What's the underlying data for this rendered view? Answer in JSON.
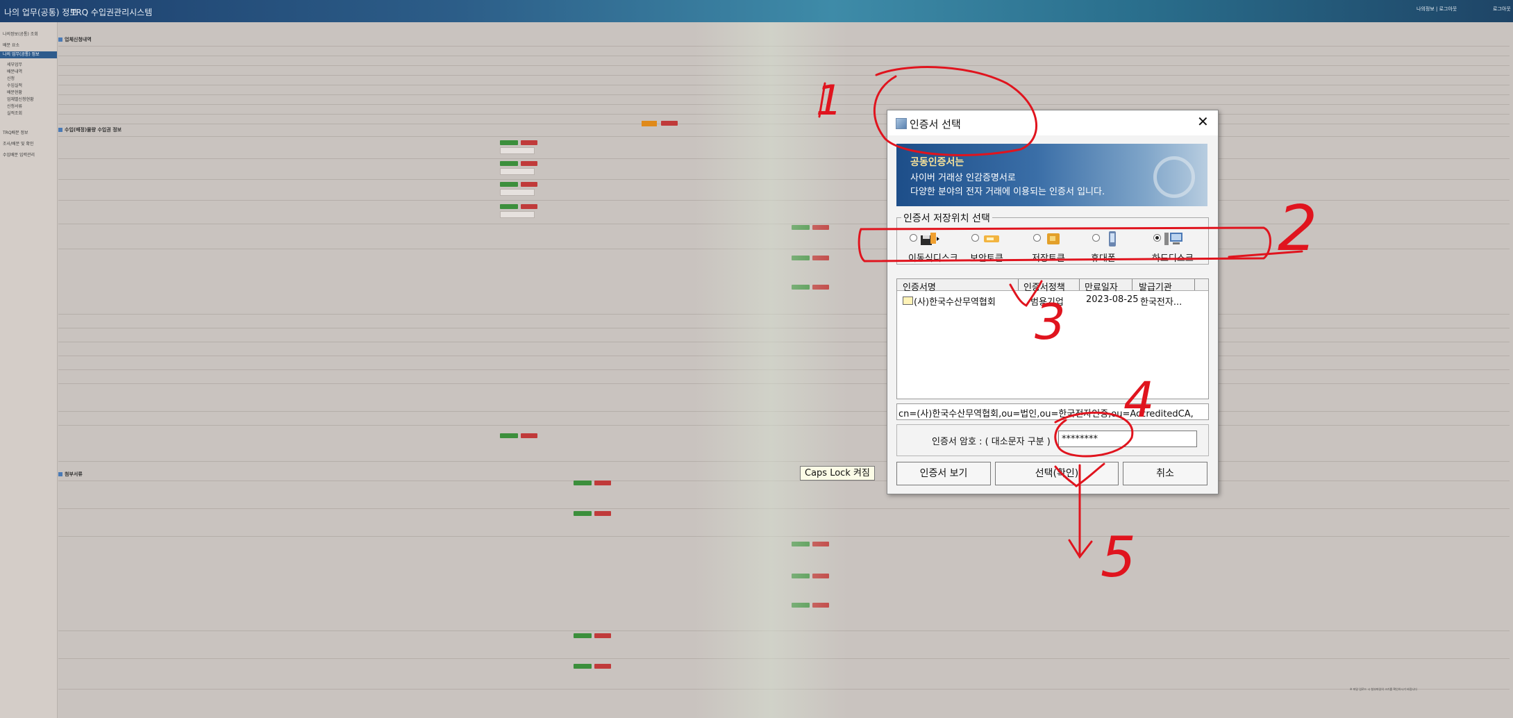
{
  "app": {
    "tab1": "나의 업무(공통) 정보",
    "tab2": "TRQ 수입권관리시스템",
    "util_text": "나의정보 | 로그아웃",
    "logout": "로그아웃"
  },
  "sidebar": {
    "items": [
      "나의정보(공통) 조회",
      "배분 요소",
      "나의 업무(공통) 정보",
      "세부업무",
      "배분내역",
      "신청",
      "수입실적",
      "배분현황",
      "업체별신청현황",
      "신청서류",
      "실적조회",
      "TRQ배분 정보",
      "조사/배분 및 확인",
      "수입배분 입력관리"
    ]
  },
  "main": {
    "section1": "업체신청내역",
    "section2": "수입(배정)물량 수입권 정보",
    "section3": "첨부서류",
    "footer_note": "※ 파일 업로드 시 첨부파일의 크기를 확인하시기 바랍니다"
  },
  "dialog": {
    "title": "인증서 선택",
    "banner_line1": "공동인증서는",
    "banner_line2": "사이버 거래상 인감증명서로",
    "banner_line3": "다양한 분야의 전자 거래에 이용되는 인증서 입니다.",
    "storage_legend": "인증서 저장위치 선택",
    "storage_options": [
      {
        "label": "이동식디스크",
        "icon": "usb-drive-icon",
        "selected": false
      },
      {
        "label": "보안토큰",
        "icon": "security-token-icon",
        "selected": false
      },
      {
        "label": "저장토큰",
        "icon": "smart-card-icon",
        "selected": false
      },
      {
        "label": "휴대폰",
        "icon": "mobile-phone-icon",
        "selected": false
      },
      {
        "label": "하드디스크",
        "icon": "hard-disk-icon",
        "selected": true
      }
    ],
    "table_headers": [
      "인증서명",
      "인증서정책",
      "만료일자",
      "발급기관"
    ],
    "cert_rows": [
      {
        "name": "(사)한국수산무역협회",
        "policy": "범용기업",
        "expiry": "2023-08-25",
        "issuer": "한국전자..."
      }
    ],
    "dn": "cn=(사)한국수산무역협회,ou=법인,ou=한국전자인증,ou=AccreditedCA,",
    "password_label": "인증서 암호 : ( 대소문자 구분 )",
    "password_value": "********",
    "buttons": {
      "view": "인증서 보기",
      "confirm": "선택(확인)",
      "cancel": "취소"
    }
  },
  "tooltip": "Caps Lock 켜짐",
  "annotations": [
    "1",
    "2",
    "3",
    "4",
    "5"
  ],
  "colors": {
    "annotation": "#e0141e",
    "accent": "#2e5b8c",
    "ok_button": "#3c8f3c",
    "delete_button": "#c03a3a"
  }
}
